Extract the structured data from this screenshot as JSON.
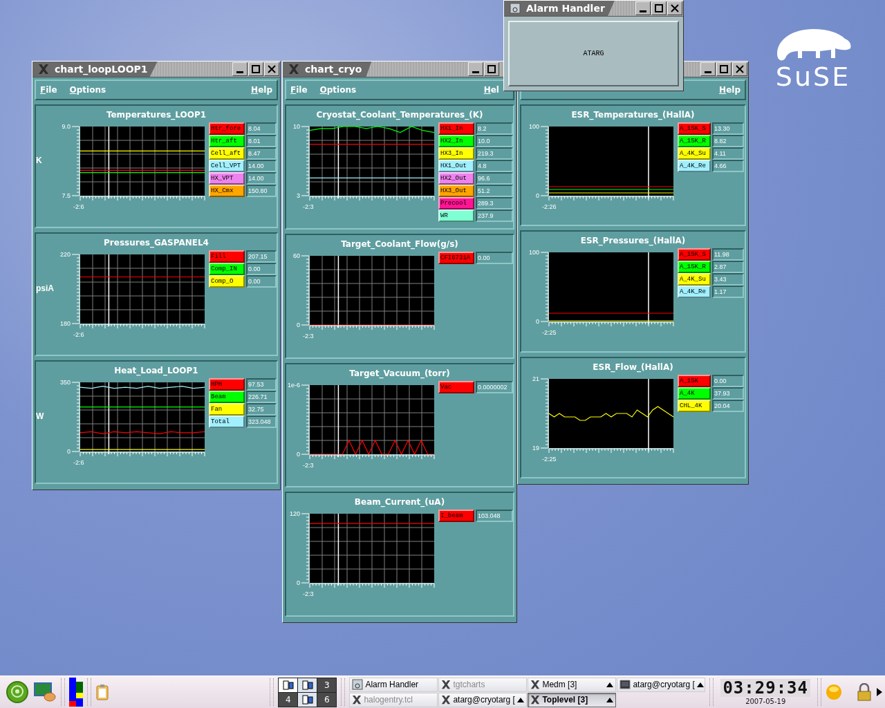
{
  "logo": {
    "text": "SuSE"
  },
  "windows": [
    {
      "title": "chart_loopLOOP1",
      "menu": [
        "File",
        "Options"
      ],
      "help": "Help",
      "panels": [
        {
          "title": "Temperatures_LOOP1",
          "time_label": "-2:6",
          "channels": [
            {
              "name": "Htr_fore",
              "value": "8.04",
              "color": "#ff0000"
            },
            {
              "name": "Htr_aft",
              "value": "8.01",
              "color": "#00ff00"
            },
            {
              "name": "Cell_aft",
              "value": "8.47",
              "color": "#ffff00"
            },
            {
              "name": "Cell_VPT",
              "value": "14.00",
              "color": "#a0f0ff"
            },
            {
              "name": "HX_VPT",
              "value": "14.00",
              "color": "#ee82ee"
            },
            {
              "name": "HX_Cmx",
              "value": "150.80",
              "color": "#ffa500"
            }
          ],
          "chart_data": {
            "type": "line",
            "ylabel": "K",
            "grid": true,
            "ylim": [
              7.5,
              9.0
            ],
            "yticks": [
              {
                "value": 7.5,
                "label": "7.5"
              },
              {
                "value": 9.0,
                "label": "9.0"
              }
            ],
            "series": [
              {
                "color": "#ff0000",
                "values": [
                  8.05,
                  8.05,
                  8.05,
                  8.05,
                  8.05,
                  8.05,
                  8.05,
                  8.05,
                  8.05,
                  8.05,
                  8.05,
                  8.05
                ]
              },
              {
                "color": "#00ff00",
                "values": [
                  8.0,
                  8.0,
                  8.0,
                  8.0,
                  8.0,
                  8.0,
                  8.0,
                  8.0,
                  8.0,
                  8.0,
                  8.0,
                  8.0
                ]
              },
              {
                "color": "#ffff00",
                "values": [
                  8.47,
                  8.47,
                  8.47,
                  8.47,
                  8.47,
                  8.47,
                  8.47,
                  8.47,
                  8.47,
                  8.47,
                  8.47,
                  8.47
                ]
              }
            ]
          }
        },
        {
          "title": "Pressures_GASPANEL4",
          "time_label": "-2:6",
          "channels": [
            {
              "name": "Fill",
              "value": "207.15",
              "color": "#ff0000"
            },
            {
              "name": "Comp_IN",
              "value": "0.00",
              "color": "#00ff00"
            },
            {
              "name": "Comp_O",
              "value": "0.00",
              "color": "#ffff00"
            }
          ],
          "chart_data": {
            "type": "line",
            "ylabel": "psiA",
            "grid": true,
            "ylim": [
              180,
              220
            ],
            "yticks": [
              180,
              220
            ],
            "series": [
              {
                "color": "#ff0000",
                "values": [
                  207,
                  207,
                  207,
                  207,
                  207,
                  207,
                  207,
                  207,
                  207,
                  207,
                  207,
                  207
                ]
              }
            ]
          }
        },
        {
          "title": "Heat_Load_LOOP1",
          "time_label": "-2:6",
          "channels": [
            {
              "name": "HPH",
              "value": "97.53",
              "color": "#ff0000"
            },
            {
              "name": "Beam",
              "value": "226.71",
              "color": "#00ff00"
            },
            {
              "name": "Fan",
              "value": "32.75",
              "color": "#ffff00"
            },
            {
              "name": "Total",
              "value": "323.048",
              "color": "#a0f0ff"
            }
          ],
          "chart_data": {
            "type": "line",
            "ylabel": "W",
            "grid": true,
            "ylim": [
              0,
              350
            ],
            "yticks": [
              0,
              350
            ],
            "series": [
              {
                "color": "#ff0000",
                "values": [
                  95,
                  100,
                  90,
                  100,
                  95,
                  100,
                  95,
                  90,
                  100,
                  95,
                  95,
                  100
                ]
              },
              {
                "color": "#00ff00",
                "values": [
                  225,
                  225,
                  225,
                  225,
                  225,
                  225,
                  225,
                  225,
                  225,
                  225,
                  225,
                  225
                ]
              },
              {
                "color": "#ffff00",
                "values": [
                  10,
                  10,
                  10,
                  10,
                  10,
                  10,
                  10,
                  10,
                  10,
                  10,
                  10,
                  10
                ]
              },
              {
                "color": "#a0f0ff",
                "values": [
                  325,
                  320,
                  330,
                  320,
                  325,
                  320,
                  330,
                  320,
                  325,
                  330,
                  320,
                  325
                ]
              }
            ]
          }
        }
      ]
    },
    {
      "title": "chart_cryo",
      "menu": [
        "File",
        "Options"
      ],
      "help": "Hel",
      "panels": [
        {
          "title": "Cryostat_Coolant_Temperatures_(K)",
          "time_label": "-2:3",
          "channels": [
            {
              "name": "HX1_In",
              "value": "8.2",
              "color": "#ff0000"
            },
            {
              "name": "HX2_In",
              "value": "10.0",
              "color": "#00ff00"
            },
            {
              "name": "HX3_In",
              "value": "219.3",
              "color": "#ffff00"
            },
            {
              "name": "HX1_Out",
              "value": "4.8",
              "color": "#a0f0ff"
            },
            {
              "name": "HX2_Out",
              "value": "96.6",
              "color": "#ee82ee"
            },
            {
              "name": "HX3_Out",
              "value": "51.2",
              "color": "#ffa500"
            },
            {
              "name": "Precool",
              "value": "289.3",
              "color": "#ff1493"
            },
            {
              "name": "WR",
              "value": "237.9",
              "color": "#7fffd4"
            }
          ],
          "chart_data": {
            "type": "line",
            "grid": true,
            "ylim": [
              3,
              10
            ],
            "yticks": [
              3,
              10
            ],
            "series": [
              {
                "color": "#ff0000",
                "values": [
                  8.2,
                  8.2,
                  8.2,
                  8.2,
                  8.2,
                  8.2,
                  8.2,
                  8.2,
                  8.2,
                  8.2,
                  8.2,
                  8.2
                ]
              },
              {
                "color": "#00ff00",
                "values": [
                  9.6,
                  9.8,
                  9.8,
                  10,
                  10,
                  9.8,
                  10,
                  9.8,
                  9.4,
                  10,
                  9.6,
                  9.4
                ]
              },
              {
                "color": "#a0f0ff",
                "values": [
                  4.8,
                  4.8,
                  4.8,
                  4.8,
                  4.8,
                  4.8,
                  4.8,
                  4.8,
                  4.8,
                  4.8,
                  4.8,
                  4.8
                ]
              }
            ]
          }
        },
        {
          "title": "Target_Coolant_Flow(g/s)",
          "time_label": "-2:3",
          "channels": [
            {
              "name": "CFI6731A",
              "value": "0.00",
              "color": "#ff0000"
            }
          ],
          "chart_data": {
            "type": "line",
            "grid": true,
            "ylim": [
              0,
              60
            ],
            "yticks": [
              0,
              60
            ],
            "series": [
              {
                "color": "#ff0000",
                "values": [
                  0,
                  0,
                  0,
                  0,
                  0,
                  0,
                  0,
                  0,
                  0,
                  0,
                  0,
                  0
                ]
              }
            ]
          }
        },
        {
          "title": "Target_Vacuum_(torr)",
          "time_label": "-2:3",
          "channels": [
            {
              "name": "Vac",
              "value": "0.0000002",
              "color": "#ff0000"
            }
          ],
          "chart_data": {
            "type": "line",
            "grid": true,
            "ylim": [
              0,
              1e-06
            ],
            "yticks": [
              0,
              {
                "value": 1e-06,
                "label": "1e-6"
              }
            ],
            "series": [
              {
                "color": "#ff0000",
                "values": [
                  0,
                  0,
                  0,
                  0,
                  0,
                  0,
                  2e-07,
                  0,
                  2e-07,
                  0,
                  2e-07,
                  0,
                  0,
                  2e-07,
                  0,
                  2e-07,
                  0,
                  2e-07,
                  0,
                  0
                ]
              }
            ]
          }
        },
        {
          "title": "Beam_Current_(uA)",
          "time_label": "-2:3",
          "channels": [
            {
              "name": "I_beam",
              "value": "103.048",
              "color": "#ff0000"
            }
          ],
          "chart_data": {
            "type": "line",
            "grid": true,
            "ylim": [
              0,
              120
            ],
            "yticks": [
              0,
              120
            ],
            "series": [
              {
                "color": "#ff0000",
                "values": [
                  103,
                  103,
                  103,
                  103,
                  103,
                  103,
                  103,
                  103,
                  103,
                  103,
                  103,
                  103
                ]
              }
            ]
          }
        }
      ]
    },
    {
      "help": "Help",
      "panels": [
        {
          "title": "ESR_Temperatures_(HallA)",
          "time_label": "-2:26",
          "channels": [
            {
              "name": "A_15K_S",
              "value": "13.30",
              "color": "#ff0000"
            },
            {
              "name": "A_15K_R",
              "value": "8.82",
              "color": "#00ff00"
            },
            {
              "name": "A_4K_Su",
              "value": "4.11",
              "color": "#ffff00"
            },
            {
              "name": "A_4K_Re",
              "value": "4.66",
              "color": "#a0f0ff"
            }
          ],
          "chart_data": {
            "type": "line",
            "grid": false,
            "ylim": [
              0,
              100
            ],
            "yticks": [
              0,
              100
            ],
            "series": [
              {
                "color": "#ff0000",
                "values": [
                  13,
                  13,
                  13,
                  13,
                  13,
                  13,
                  13,
                  13
                ]
              },
              {
                "color": "#00ff00",
                "values": [
                  9,
                  9,
                  9,
                  9,
                  9,
                  9,
                  9,
                  9
                ]
              },
              {
                "color": "#ffff00",
                "values": [
                  4,
                  4,
                  4,
                  4,
                  4,
                  4,
                  4,
                  4
                ]
              }
            ]
          }
        },
        {
          "title": "ESR_Pressures_(HallA)",
          "time_label": "-2:25",
          "channels": [
            {
              "name": "A_15K_S",
              "value": "11.98",
              "color": "#ff0000"
            },
            {
              "name": "A_15K_R",
              "value": "2.87",
              "color": "#00ff00"
            },
            {
              "name": "A_4K_Su",
              "value": "3.43",
              "color": "#ffff00"
            },
            {
              "name": "A_4K_Re",
              "value": "1.17",
              "color": "#a0f0ff"
            }
          ],
          "chart_data": {
            "type": "line",
            "grid": false,
            "ylim": [
              0,
              100
            ],
            "yticks": [
              0,
              100
            ],
            "series": [
              {
                "color": "#ff0000",
                "values": [
                  12,
                  12,
                  12,
                  12,
                  12,
                  12,
                  12,
                  12
                ]
              },
              {
                "color": "#ffff00",
                "values": [
                  1,
                  1,
                  1,
                  1,
                  1,
                  1,
                  1,
                  1
                ]
              }
            ]
          }
        },
        {
          "title": "ESR_Flow_(HallA)",
          "time_label": "-2:25",
          "channels": [
            {
              "name": "A_15K",
              "value": "0.00",
              "color": "#ff0000"
            },
            {
              "name": "A_4K",
              "value": "37.93",
              "color": "#00ff00"
            },
            {
              "name": "CHL_4K",
              "value": "20.04",
              "color": "#ffff00"
            }
          ],
          "chart_data": {
            "type": "line",
            "grid": false,
            "ylim": [
              19,
              21
            ],
            "yticks": [
              19,
              21
            ],
            "series": [
              {
                "color": "#ffff00",
                "values": [
                  20.0,
                  19.9,
                  20.0,
                  19.9,
                  19.9,
                  19.9,
                  19.8,
                  19.8,
                  19.9,
                  19.9,
                  19.9,
                  20.0,
                  19.9,
                  20.0,
                  20.0,
                  20.0,
                  19.9,
                  20.1,
                  20.0,
                  19.9,
                  20.1,
                  20.2,
                  20.1,
                  20.0,
                  19.9
                ]
              }
            ]
          }
        }
      ]
    }
  ],
  "alarm": {
    "title": "Alarm Handler",
    "group": "ATARG"
  },
  "taskbar": {
    "pager": [
      {
        "kind": "thumb",
        "selected": true
      },
      {
        "kind": "thumb",
        "selected": false
      },
      {
        "kind": "number",
        "label": "3",
        "selected": false
      },
      {
        "kind": "number",
        "label": "4",
        "selected": false
      },
      {
        "kind": "thumb",
        "selected": false
      },
      {
        "kind": "number",
        "label": "6",
        "selected": false
      }
    ],
    "tasks": [
      {
        "label": "Alarm Handler",
        "kind": "alarm",
        "minimized": false,
        "selected": false,
        "grouped": false
      },
      {
        "label": "tgtcharts",
        "kind": "x",
        "minimized": true,
        "selected": false,
        "grouped": false
      },
      {
        "label": "Medm [3]",
        "kind": "x",
        "minimized": false,
        "selected": false,
        "grouped": true
      },
      {
        "label": "atarg@cryotarg [",
        "kind": "terminal",
        "minimized": false,
        "selected": false,
        "grouped": true
      },
      {
        "label": "halogentry.tcl",
        "kind": "x",
        "minimized": true,
        "selected": false,
        "grouped": false
      },
      {
        "label": "atarg@cryotarg [",
        "kind": "x",
        "minimized": false,
        "selected": false,
        "grouped": true
      },
      {
        "label": "Toplevel [3]",
        "kind": "x",
        "minimized": false,
        "selected": true,
        "grouped": true
      }
    ],
    "clock": {
      "time": "03:29:34",
      "date": "2007-05-19"
    }
  }
}
